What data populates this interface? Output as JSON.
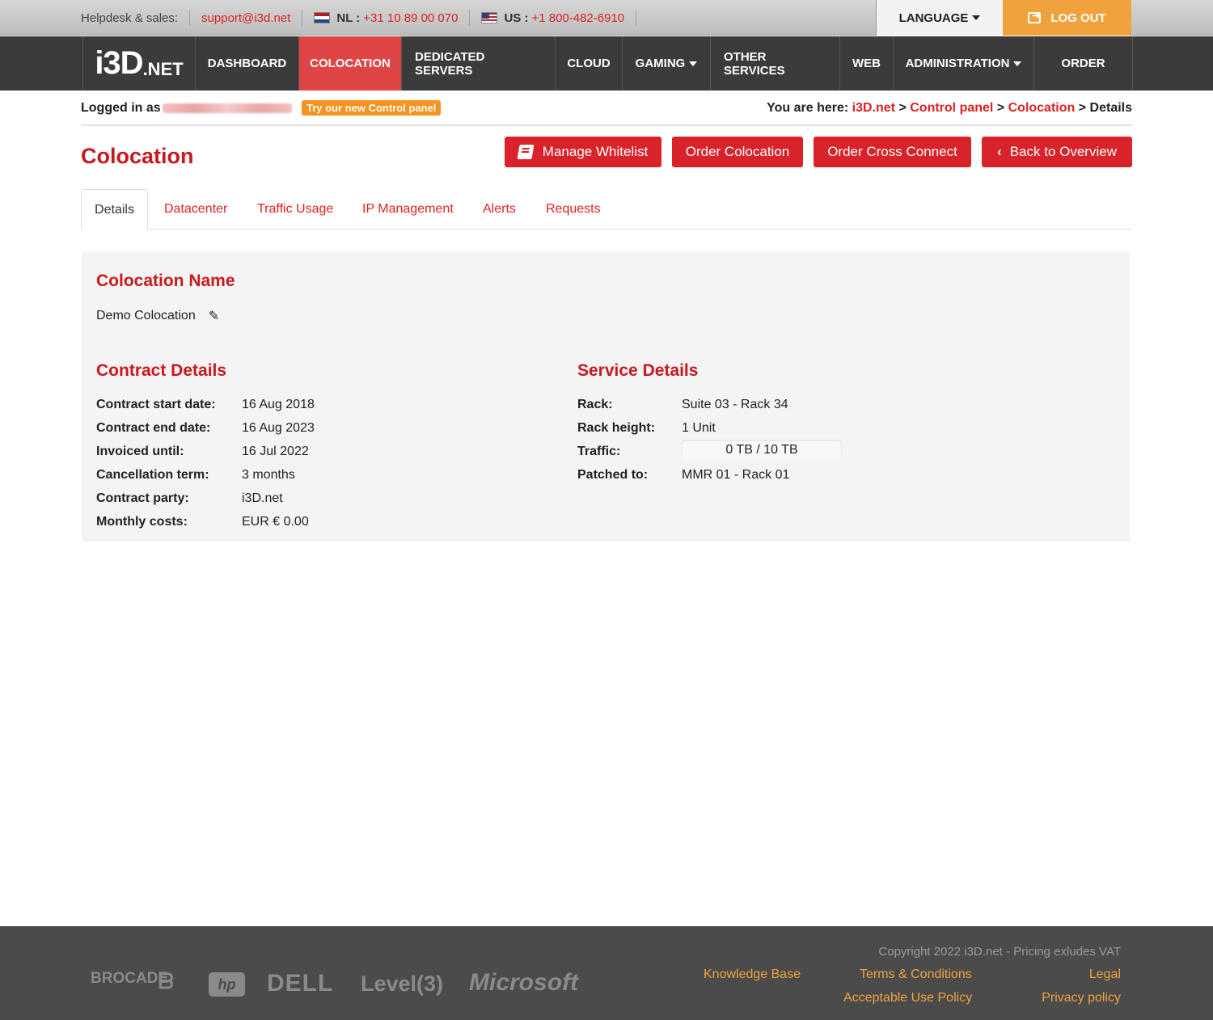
{
  "topbar": {
    "helpdesk_label": "Helpdesk & sales:",
    "email": "support@i3d.net",
    "nl_label": "NL :",
    "nl_phone": "+31 10 89 00 070",
    "us_label": "US :",
    "us_phone": "+1 800-482-6910",
    "language_label": "LANGUAGE",
    "logout_label": "LOG OUT"
  },
  "logo": {
    "main": "i3D",
    "suffix": ".NET"
  },
  "nav": {
    "dashboard": "DASHBOARD",
    "colocation": "COLOCATION",
    "dedicated": "DEDICATED SERVERS",
    "cloud": "CLOUD",
    "gaming": "GAMING",
    "other": "OTHER SERVICES",
    "web": "WEB",
    "administration": "ADMINISTRATION",
    "order": "ORDER"
  },
  "subheader": {
    "logged_in_label": "Logged in as",
    "try_new_panel": "Try our new Control panel",
    "you_are_here": "You are here:",
    "crumb_1": "i3D.net",
    "crumb_2": "Control panel",
    "crumb_3": "Colocation",
    "crumb_4": "Details",
    "crumb_sep": ">"
  },
  "page": {
    "title": "Colocation",
    "btn_whitelist": "Manage Whitelist",
    "btn_order_colocation": "Order Colocation",
    "btn_order_cross_connect": "Order Cross Connect",
    "btn_back": "Back to Overview"
  },
  "tabs": {
    "details": "Details",
    "datacenter": "Datacenter",
    "traffic": "Traffic Usage",
    "ip": "IP Management",
    "alerts": "Alerts",
    "requests": "Requests"
  },
  "colocation_name": {
    "title": "Colocation Name",
    "value": "Demo Colocation"
  },
  "contract": {
    "title": "Contract Details",
    "rows": [
      {
        "label": "Contract start date:",
        "value": "16 Aug 2018"
      },
      {
        "label": "Contract end date:",
        "value": "16 Aug 2023"
      },
      {
        "label": "Invoiced until:",
        "value": "16 Jul 2022"
      },
      {
        "label": "Cancellation term:",
        "value": "3 months"
      },
      {
        "label": "Contract party:",
        "value": "i3D.net"
      },
      {
        "label": "Monthly costs:",
        "value": "EUR € 0.00"
      }
    ]
  },
  "service": {
    "title": "Service Details",
    "rows": [
      {
        "label": "Rack:",
        "value": "Suite 03 - Rack 34"
      },
      {
        "label": "Rack height:",
        "value": "1 Unit"
      },
      {
        "label": "Traffic:",
        "value": "0 TB / 10 TB"
      },
      {
        "label": "Patched to:",
        "value": "MMR 01 - Rack 01"
      }
    ],
    "traffic_fraction": 0
  },
  "footer": {
    "partners": [
      "BROCADE",
      "hp",
      "DELL",
      "Level(3)",
      "Microsoft"
    ],
    "copyright": "Copyright 2022 i3D.net - Pricing exludes VAT",
    "knowledge_base": "Knowledge Base",
    "terms": "Terms & Conditions",
    "legal": "Legal",
    "aup": "Acceptable Use Policy",
    "privacy": "Privacy policy"
  },
  "colors": {
    "brand_red": "#d9232a",
    "heading_red": "#c8191e",
    "orange": "#f0a23c",
    "nav_bg": "#3b3b3b"
  }
}
